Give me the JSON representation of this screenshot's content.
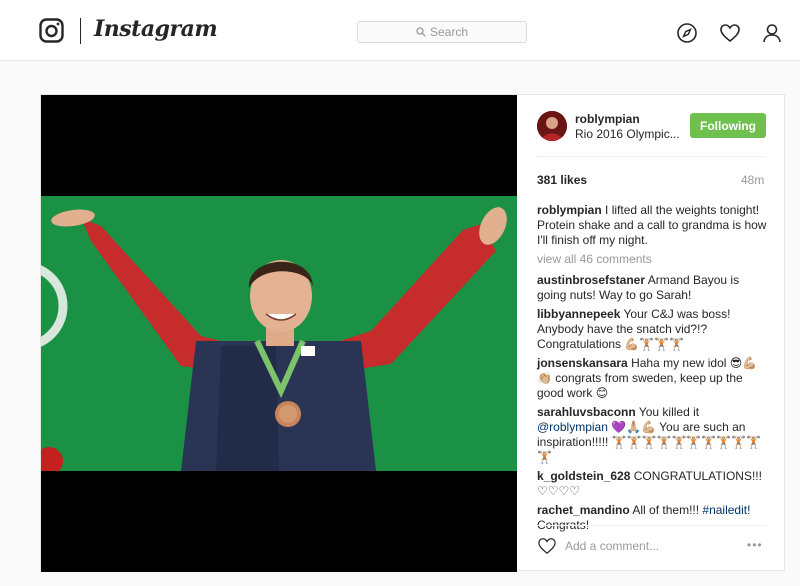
{
  "nav": {
    "logo_text": "Instagram",
    "search_placeholder": "Search",
    "icons": [
      "instagram-glyph-icon",
      "search-icon",
      "compass-icon",
      "heart-icon",
      "user-icon"
    ]
  },
  "post": {
    "username": "roblympian",
    "location": "Rio 2016 Olympic...",
    "follow_label": "Following",
    "likes": "381 likes",
    "time": "48m",
    "caption_user": "roblympian",
    "caption_text": "I lifted all the weights tonight! Protein shake and a call to grandma is how I'll finish off my night.",
    "view_all": "view all 46 comments",
    "comments": [
      {
        "user": "austinbrosefstaner",
        "text": "Armand Bayou is going nuts! Way to go Sarah!"
      },
      {
        "user": "libbyannepeek",
        "text": "Your C&J was boss! Anybody have the snatch vid?!? Congratulations 💪🏼🏋🏼🏋🏼🏋🏼"
      },
      {
        "user": "jonsenskansara",
        "text": "Haha my new idol 😎💪🏼👏🏼 congrats from sweden, keep up the good work 😊"
      },
      {
        "user": "sarahluvsbaconn",
        "text_before": "You killed it ",
        "mention": "@roblympian",
        "text_after": " 💜🙏🏼💪🏼 You are such an inspiration!!!!! 🏋🏼🏋🏼🏋🏼🏋🏼🏋🏼🏋🏼🏋🏼🏋🏼🏋🏼🏋🏼🏋🏼"
      },
      {
        "user": "k_goldstein_628",
        "text": "CONGRATULATIONS!!! ♡♡♡♡"
      },
      {
        "user": "rachet_mandino",
        "text_before": "All of them!!! ",
        "mention": "#nailedit!",
        "text_after": " Congrats!"
      }
    ],
    "add_comment_placeholder": "Add a comment...",
    "more_label": "•••"
  },
  "colors": {
    "follow_button": "#70c050",
    "link": "#003569",
    "muted": "#999999",
    "backdrop_green": "#1f9a4c"
  }
}
